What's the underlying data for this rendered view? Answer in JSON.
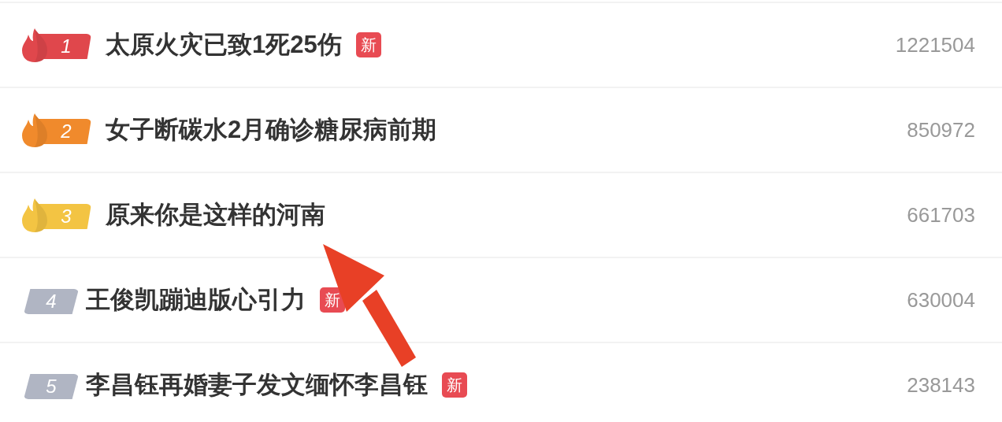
{
  "hot_list": [
    {
      "rank": "1",
      "kind": "hot",
      "color": "#e0474c",
      "title": "太原火灾已致1死25伤",
      "is_new": true,
      "count": "1221504"
    },
    {
      "rank": "2",
      "kind": "hot",
      "color": "#f08a2c",
      "title": "女子断碳水2月确诊糖尿病前期",
      "is_new": false,
      "count": "850972"
    },
    {
      "rank": "3",
      "kind": "hot",
      "color": "#f3c443",
      "title": "原来你是这样的河南",
      "is_new": false,
      "count": "661703"
    },
    {
      "rank": "4",
      "kind": "plain",
      "color": "#b0b5c3",
      "title": "王俊凯蹦迪版心引力",
      "is_new": true,
      "new_label": "新",
      "count": "630004"
    },
    {
      "rank": "5",
      "kind": "plain",
      "color": "#b0b5c3",
      "title": "李昌钰再婚妻子发文缅怀李昌钰",
      "is_new": true,
      "new_label": "新",
      "count": "238143"
    }
  ],
  "new_label": "新",
  "overlay": {
    "kind": "arrow"
  }
}
